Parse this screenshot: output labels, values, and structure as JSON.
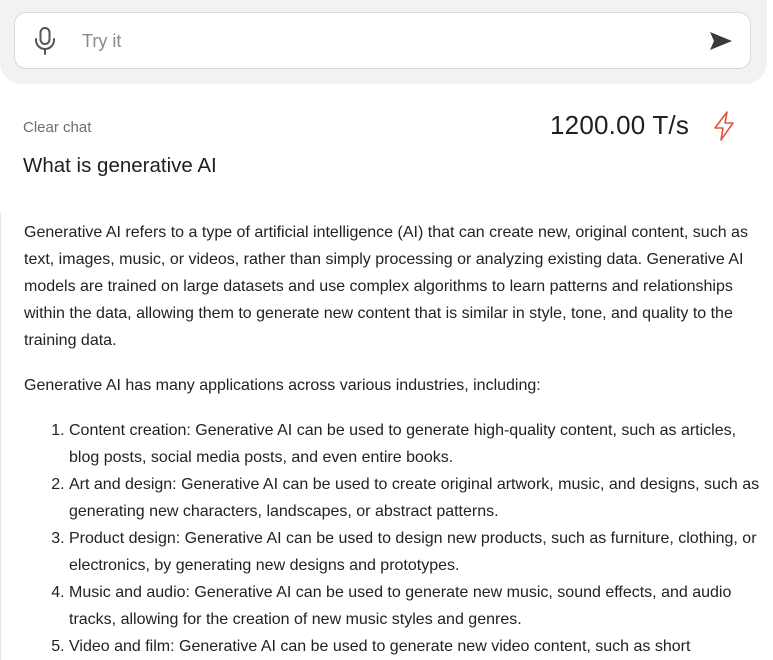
{
  "input": {
    "placeholder": "Try it",
    "icons": {
      "mic": "microphone-icon",
      "send": "send-arrow-icon"
    }
  },
  "toolbar": {
    "clear_label": "Clear chat",
    "speed": "1200.00 T/s",
    "speed_icon": "lightning-bolt-icon",
    "accent_color": "#e5533d"
  },
  "chat": {
    "question": "What is generative AI",
    "paragraphs": [
      "Generative AI refers to a type of artificial intelligence (AI) that can create new, original content, such as text, images, music, or videos, rather than simply processing or analyzing existing data. Generative AI models are trained on large datasets and use complex algorithms to learn patterns and relationships within the data, allowing them to generate new content that is similar in style, tone, and quality to the training data.",
      "Generative AI has many applications across various industries, including:"
    ],
    "list": [
      "Content creation: Generative AI can be used to generate high-quality content, such as articles, blog posts, social media posts, and even entire books.",
      "Art and design: Generative AI can be used to create original artwork, music, and designs, such as generating new characters, landscapes, or abstract patterns.",
      "Product design: Generative AI can be used to design new products, such as furniture, clothing, or electronics, by generating new designs and prototypes.",
      "Music and audio: Generative AI can be used to generate new music, sound effects, and audio tracks, allowing for the creation of new music styles and genres.",
      "Video and film: Generative AI can be used to generate new video content, such as short"
    ]
  }
}
